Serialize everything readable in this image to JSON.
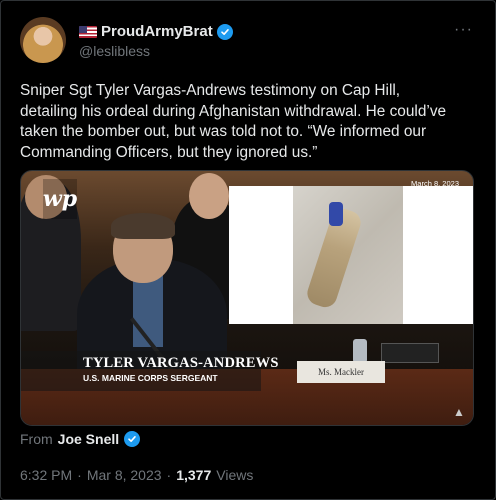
{
  "author": {
    "display_name": "ProudArmyBrat",
    "handle": "@leslibless",
    "flag_icon": "us-flag-icon",
    "verified": true,
    "verified_color": "#1d9bf0"
  },
  "more_menu": {
    "glyph": "···"
  },
  "tweet": {
    "text": "Sniper Sgt Tyler Vargas-Andrews testimony on Cap Hill, detailing his ordeal during Afghanistan withdrawal. He could’ve taken the bomber out, but was told not to. “We informed our Commanding Officers, but they ignored us.”"
  },
  "media": {
    "logo_text": "wp",
    "date_stamp": "March 8, 2023",
    "lower_third_name": "TYLER VARGAS-ANDREWS",
    "lower_third_title": "U.S. MARINE CORPS SERGEANT",
    "nameplate": "Ms. Mackler"
  },
  "source": {
    "label": "From",
    "name": "Joe Snell",
    "verified": true
  },
  "meta": {
    "time": "6:32 PM",
    "separator": "·",
    "date": "Mar 8, 2023",
    "views_count": "1,377",
    "views_label": "Views"
  },
  "colors": {
    "background": "#000000",
    "text_primary": "#e7e9ea",
    "text_secondary": "#71767b",
    "border": "#2f3336",
    "accent": "#1d9bf0"
  }
}
